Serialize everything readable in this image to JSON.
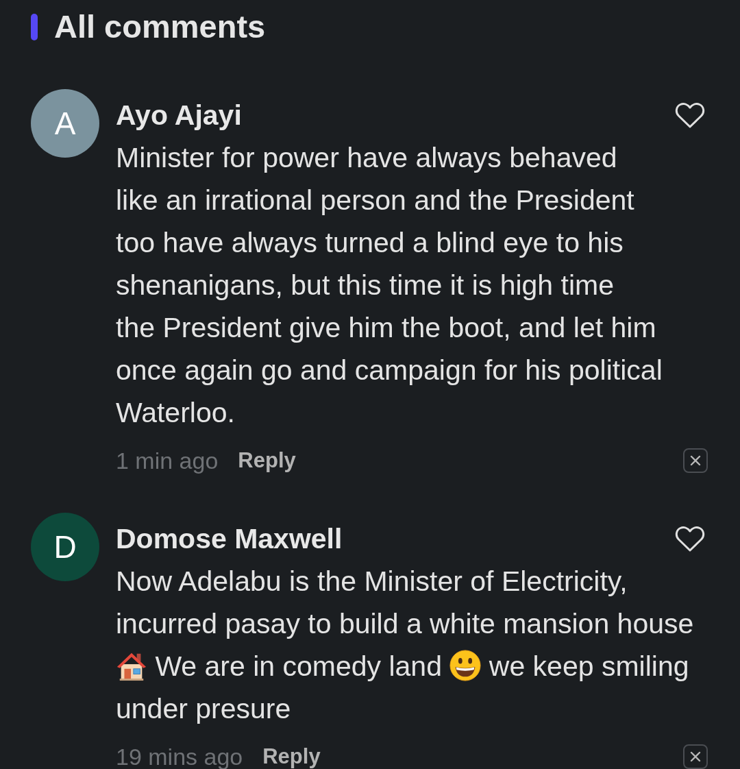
{
  "header": {
    "title": "All comments"
  },
  "comments": [
    {
      "avatar_letter": "A",
      "color": "#7b939e",
      "author": "Ayo Ajayi",
      "liked": false,
      "body": [
        {
          "kind": "text",
          "text": "Minister for power have always behaved\nlike an irrational person and the President\ntoo have always turned a blind eye to his\nshenanigans, but this time it is high time\nthe President give him the boot, and let him\nonce again go and campaign for his political\nWaterloo."
        }
      ],
      "time": "1 min ago",
      "reply_label": "Reply"
    },
    {
      "avatar_letter": "D",
      "color": "#0d4a3b",
      "author": "Domose Maxwell",
      "liked": false,
      "body": [
        {
          "kind": "text",
          "text": "Now Adelabu is the Minister of Electricity, incurred pasay to build a white mansion house"
        },
        {
          "kind": "house"
        },
        {
          "kind": "text",
          "text": "We are in comedy land"
        },
        {
          "kind": "grin"
        },
        {
          "kind": "text",
          "text": "we keep smiling under presure"
        }
      ],
      "time": "19 mins ago",
      "reply_label": "Reply"
    }
  ]
}
